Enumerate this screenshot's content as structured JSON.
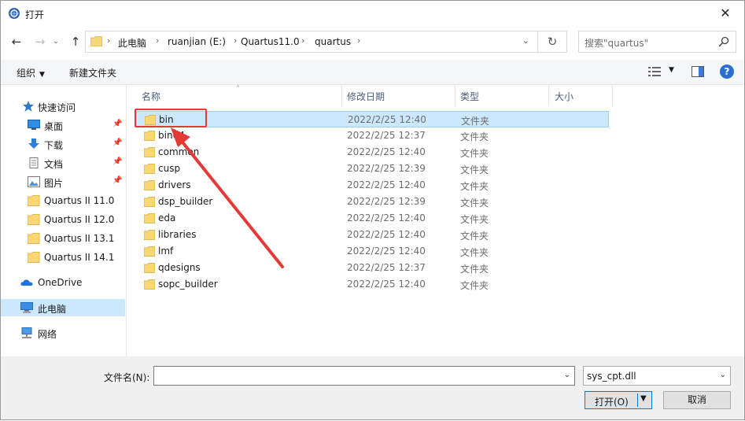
{
  "window": {
    "title": "打开",
    "close": "✕"
  },
  "nav_buttons": {
    "back": "←",
    "forward": "→",
    "up": "↑"
  },
  "address": {
    "breadcrumbs": [
      "此电脑",
      "ruanjian (E:)",
      "Quartus11.0",
      "quartus"
    ],
    "separator": "›",
    "dropdown": "⌄",
    "refresh": "↻"
  },
  "search": {
    "placeholder": "搜索\"quartus\""
  },
  "toolbar": {
    "organize": "组织",
    "new_folder": "新建文件夹",
    "caret": "▼",
    "help": "?"
  },
  "nav": {
    "quick_access": "快速访问",
    "items": [
      {
        "label": "桌面",
        "icon": "desktop-icon",
        "pinned": true
      },
      {
        "label": "下载",
        "icon": "download-icon",
        "pinned": true
      },
      {
        "label": "文档",
        "icon": "document-icon",
        "pinned": true
      },
      {
        "label": "图片",
        "icon": "pictures-icon",
        "pinned": true
      },
      {
        "label": "Quartus II 11.0",
        "icon": "folder-icon",
        "pinned": false
      },
      {
        "label": "Quartus II 12.0",
        "icon": "folder-icon",
        "pinned": false
      },
      {
        "label": "Quartus II 13.1",
        "icon": "folder-icon",
        "pinned": false
      },
      {
        "label": "Quartus II 14.1",
        "icon": "folder-icon",
        "pinned": false
      }
    ],
    "onedrive": "OneDrive",
    "this_pc": "此电脑",
    "network": "网络"
  },
  "columns": {
    "name": "名称",
    "date": "修改日期",
    "type": "类型",
    "size": "大小"
  },
  "files": [
    {
      "name": "bin",
      "date": "2022/2/25 12:40",
      "type": "文件夹",
      "selected": true
    },
    {
      "name": "bin64",
      "date": "2022/2/25 12:37",
      "type": "文件夹",
      "selected": false
    },
    {
      "name": "common",
      "date": "2022/2/25 12:40",
      "type": "文件夹",
      "selected": false
    },
    {
      "name": "cusp",
      "date": "2022/2/25 12:39",
      "type": "文件夹",
      "selected": false
    },
    {
      "name": "drivers",
      "date": "2022/2/25 12:40",
      "type": "文件夹",
      "selected": false
    },
    {
      "name": "dsp_builder",
      "date": "2022/2/25 12:39",
      "type": "文件夹",
      "selected": false
    },
    {
      "name": "eda",
      "date": "2022/2/25 12:40",
      "type": "文件夹",
      "selected": false
    },
    {
      "name": "libraries",
      "date": "2022/2/25 12:40",
      "type": "文件夹",
      "selected": false
    },
    {
      "name": "lmf",
      "date": "2022/2/25 12:40",
      "type": "文件夹",
      "selected": false
    },
    {
      "name": "qdesigns",
      "date": "2022/2/25 12:37",
      "type": "文件夹",
      "selected": false
    },
    {
      "name": "sopc_builder",
      "date": "2022/2/25 12:40",
      "type": "文件夹",
      "selected": false
    }
  ],
  "bottom": {
    "filename_label": "文件名(N):",
    "filename_value": "",
    "filter": "sys_cpt.dll",
    "open": "打开(O)",
    "cancel": "取消"
  },
  "colors": {
    "accent": "#0078d7",
    "selection": "#cce8ff",
    "annotation": "#e53935",
    "folder": "#f8d775"
  }
}
